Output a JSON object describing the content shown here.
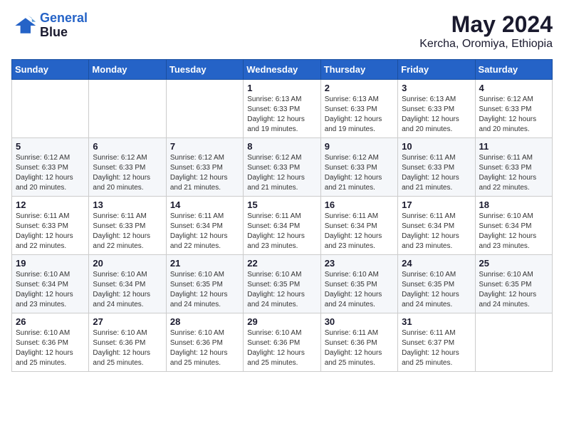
{
  "header": {
    "logo_line1": "General",
    "logo_line2": "Blue",
    "title": "May 2024",
    "subtitle": "Kercha, Oromiya, Ethiopia"
  },
  "weekdays": [
    "Sunday",
    "Monday",
    "Tuesday",
    "Wednesday",
    "Thursday",
    "Friday",
    "Saturday"
  ],
  "weeks": [
    [
      {
        "day": "",
        "info": ""
      },
      {
        "day": "",
        "info": ""
      },
      {
        "day": "",
        "info": ""
      },
      {
        "day": "1",
        "info": "Sunrise: 6:13 AM\nSunset: 6:33 PM\nDaylight: 12 hours\nand 19 minutes."
      },
      {
        "day": "2",
        "info": "Sunrise: 6:13 AM\nSunset: 6:33 PM\nDaylight: 12 hours\nand 19 minutes."
      },
      {
        "day": "3",
        "info": "Sunrise: 6:13 AM\nSunset: 6:33 PM\nDaylight: 12 hours\nand 20 minutes."
      },
      {
        "day": "4",
        "info": "Sunrise: 6:12 AM\nSunset: 6:33 PM\nDaylight: 12 hours\nand 20 minutes."
      }
    ],
    [
      {
        "day": "5",
        "info": "Sunrise: 6:12 AM\nSunset: 6:33 PM\nDaylight: 12 hours\nand 20 minutes."
      },
      {
        "day": "6",
        "info": "Sunrise: 6:12 AM\nSunset: 6:33 PM\nDaylight: 12 hours\nand 20 minutes."
      },
      {
        "day": "7",
        "info": "Sunrise: 6:12 AM\nSunset: 6:33 PM\nDaylight: 12 hours\nand 21 minutes."
      },
      {
        "day": "8",
        "info": "Sunrise: 6:12 AM\nSunset: 6:33 PM\nDaylight: 12 hours\nand 21 minutes."
      },
      {
        "day": "9",
        "info": "Sunrise: 6:12 AM\nSunset: 6:33 PM\nDaylight: 12 hours\nand 21 minutes."
      },
      {
        "day": "10",
        "info": "Sunrise: 6:11 AM\nSunset: 6:33 PM\nDaylight: 12 hours\nand 21 minutes."
      },
      {
        "day": "11",
        "info": "Sunrise: 6:11 AM\nSunset: 6:33 PM\nDaylight: 12 hours\nand 22 minutes."
      }
    ],
    [
      {
        "day": "12",
        "info": "Sunrise: 6:11 AM\nSunset: 6:33 PM\nDaylight: 12 hours\nand 22 minutes."
      },
      {
        "day": "13",
        "info": "Sunrise: 6:11 AM\nSunset: 6:33 PM\nDaylight: 12 hours\nand 22 minutes."
      },
      {
        "day": "14",
        "info": "Sunrise: 6:11 AM\nSunset: 6:34 PM\nDaylight: 12 hours\nand 22 minutes."
      },
      {
        "day": "15",
        "info": "Sunrise: 6:11 AM\nSunset: 6:34 PM\nDaylight: 12 hours\nand 23 minutes."
      },
      {
        "day": "16",
        "info": "Sunrise: 6:11 AM\nSunset: 6:34 PM\nDaylight: 12 hours\nand 23 minutes."
      },
      {
        "day": "17",
        "info": "Sunrise: 6:11 AM\nSunset: 6:34 PM\nDaylight: 12 hours\nand 23 minutes."
      },
      {
        "day": "18",
        "info": "Sunrise: 6:10 AM\nSunset: 6:34 PM\nDaylight: 12 hours\nand 23 minutes."
      }
    ],
    [
      {
        "day": "19",
        "info": "Sunrise: 6:10 AM\nSunset: 6:34 PM\nDaylight: 12 hours\nand 23 minutes."
      },
      {
        "day": "20",
        "info": "Sunrise: 6:10 AM\nSunset: 6:34 PM\nDaylight: 12 hours\nand 24 minutes."
      },
      {
        "day": "21",
        "info": "Sunrise: 6:10 AM\nSunset: 6:35 PM\nDaylight: 12 hours\nand 24 minutes."
      },
      {
        "day": "22",
        "info": "Sunrise: 6:10 AM\nSunset: 6:35 PM\nDaylight: 12 hours\nand 24 minutes."
      },
      {
        "day": "23",
        "info": "Sunrise: 6:10 AM\nSunset: 6:35 PM\nDaylight: 12 hours\nand 24 minutes."
      },
      {
        "day": "24",
        "info": "Sunrise: 6:10 AM\nSunset: 6:35 PM\nDaylight: 12 hours\nand 24 minutes."
      },
      {
        "day": "25",
        "info": "Sunrise: 6:10 AM\nSunset: 6:35 PM\nDaylight: 12 hours\nand 24 minutes."
      }
    ],
    [
      {
        "day": "26",
        "info": "Sunrise: 6:10 AM\nSunset: 6:36 PM\nDaylight: 12 hours\nand 25 minutes."
      },
      {
        "day": "27",
        "info": "Sunrise: 6:10 AM\nSunset: 6:36 PM\nDaylight: 12 hours\nand 25 minutes."
      },
      {
        "day": "28",
        "info": "Sunrise: 6:10 AM\nSunset: 6:36 PM\nDaylight: 12 hours\nand 25 minutes."
      },
      {
        "day": "29",
        "info": "Sunrise: 6:10 AM\nSunset: 6:36 PM\nDaylight: 12 hours\nand 25 minutes."
      },
      {
        "day": "30",
        "info": "Sunrise: 6:11 AM\nSunset: 6:36 PM\nDaylight: 12 hours\nand 25 minutes."
      },
      {
        "day": "31",
        "info": "Sunrise: 6:11 AM\nSunset: 6:37 PM\nDaylight: 12 hours\nand 25 minutes."
      },
      {
        "day": "",
        "info": ""
      }
    ]
  ]
}
